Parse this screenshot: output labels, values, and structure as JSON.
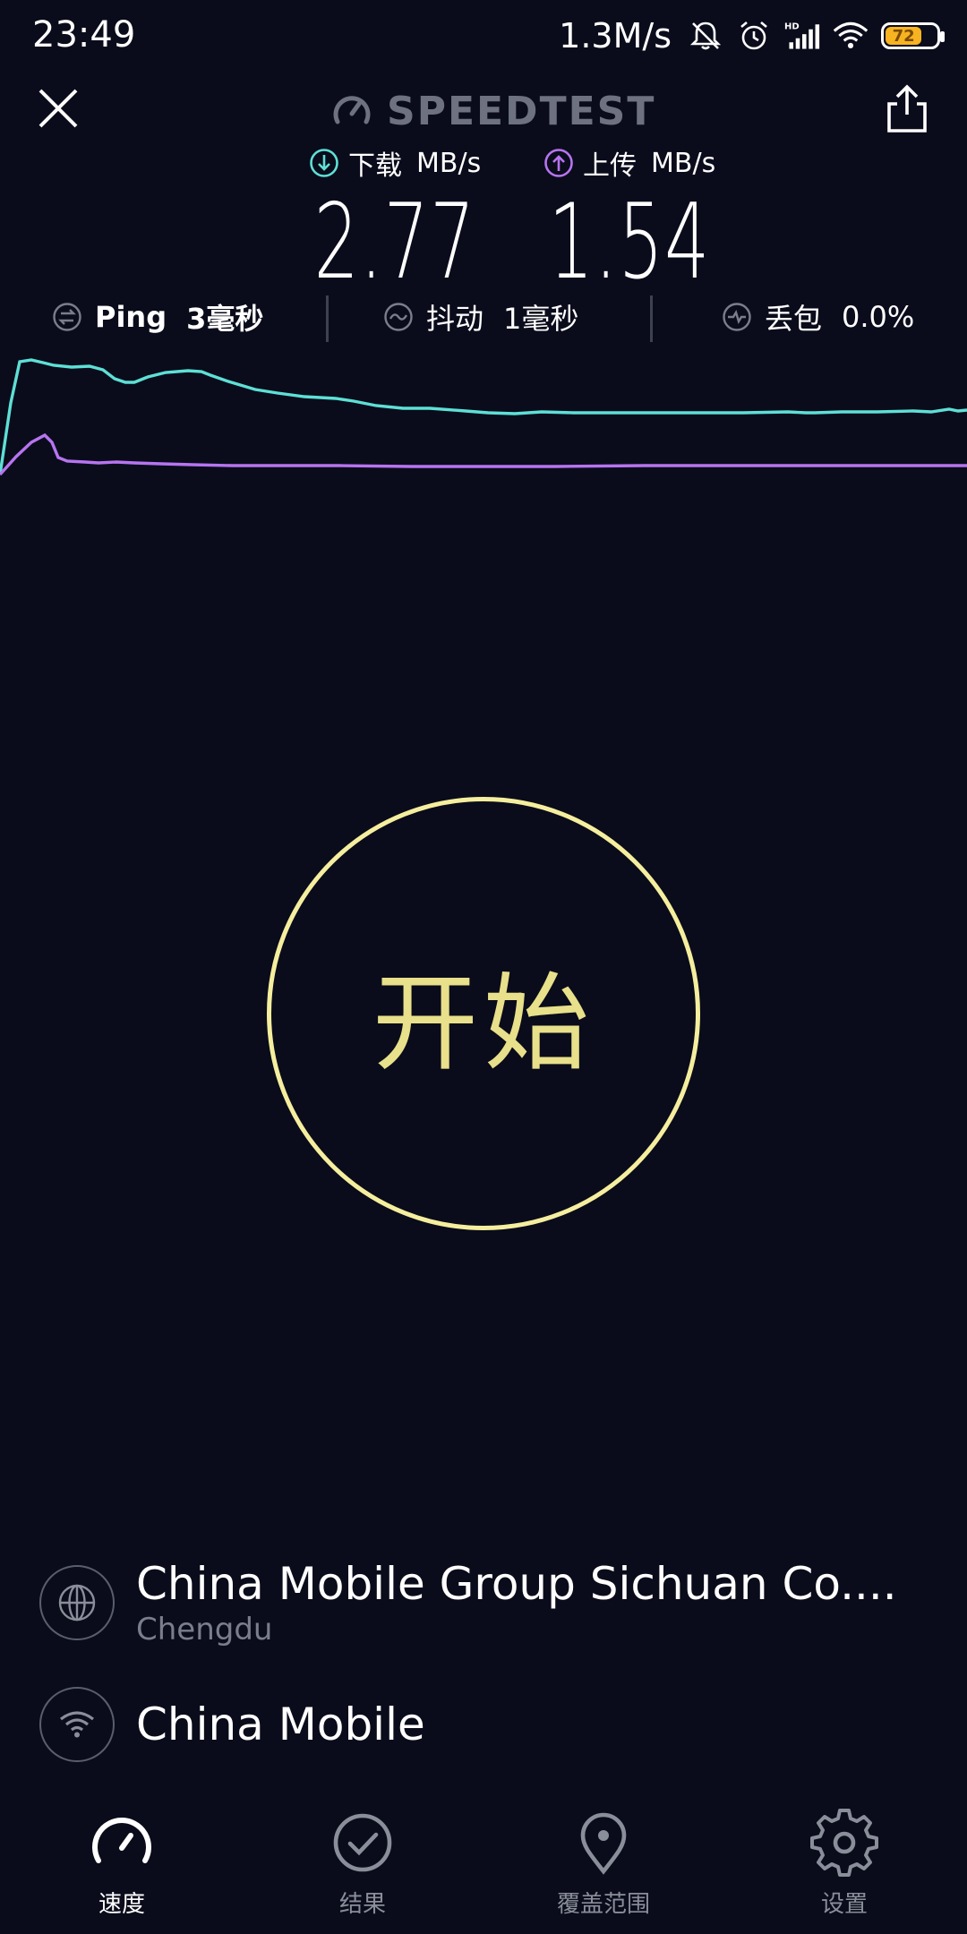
{
  "status_bar": {
    "time": "23:49",
    "net_speed": "1.3M/s",
    "battery_level": "72",
    "icons": [
      "silent-bell-icon",
      "alarm-clock-icon",
      "hd-signal-icon",
      "wifi-icon",
      "battery-icon"
    ],
    "battery_color": "#f7b321"
  },
  "header": {
    "title": "SPEEDTEST",
    "close_icon": "close-icon",
    "share_icon": "share-icon"
  },
  "metrics": {
    "download": {
      "label": "下载",
      "unit": "MB/s",
      "value": "2.77",
      "color": "#5ee0d6",
      "icon": "download-arrow-icon"
    },
    "upload": {
      "label": "上传",
      "unit": "MB/s",
      "value": "1.54",
      "color": "#b774f0",
      "icon": "upload-arrow-icon"
    }
  },
  "stats": {
    "ping": {
      "label": "Ping",
      "value": "3毫秒",
      "icon": "ping-icon"
    },
    "jitter": {
      "label": "抖动",
      "value": "1毫秒",
      "icon": "jitter-icon"
    },
    "loss": {
      "label": "丢包",
      "value": "0.0%",
      "icon": "packet-loss-icon"
    }
  },
  "graph": {
    "download_color": "#5ee0d6",
    "upload_color": "#b774f0"
  },
  "start_button": {
    "label": "开始",
    "color": "#f5ee9e"
  },
  "server": {
    "name": "China Mobile Group Sichuan Co....",
    "location": "Chengdu",
    "icon": "globe-icon"
  },
  "carrier": {
    "name": "China Mobile",
    "icon": "wifi-icon"
  },
  "nav": {
    "items": [
      {
        "label": "速度",
        "icon": "speedometer-icon",
        "active": true
      },
      {
        "label": "结果",
        "icon": "check-circle-icon",
        "active": false
      },
      {
        "label": "覆盖范围",
        "icon": "map-pin-icon",
        "active": false
      },
      {
        "label": "设置",
        "icon": "gear-icon",
        "active": false
      }
    ]
  }
}
